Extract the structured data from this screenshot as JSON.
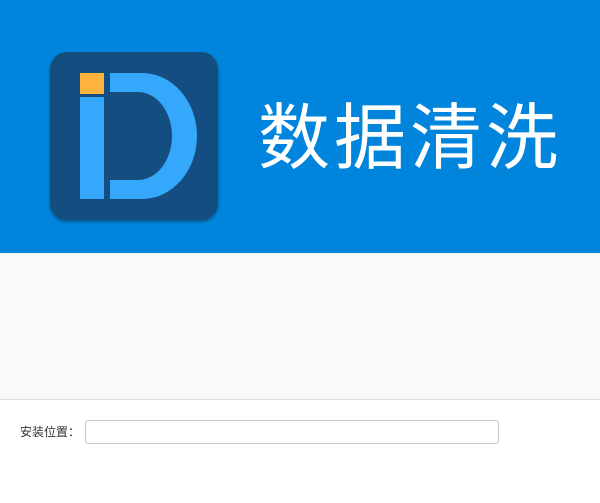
{
  "header": {
    "app_title": "数据清洗",
    "colors": {
      "banner": "#0185dc",
      "logo_bg": "#144e80",
      "logo_letter": "#35a8fb",
      "logo_accent": "#feb33d"
    }
  },
  "install": {
    "label": "安装位置：",
    "value": "",
    "placeholder": ""
  }
}
